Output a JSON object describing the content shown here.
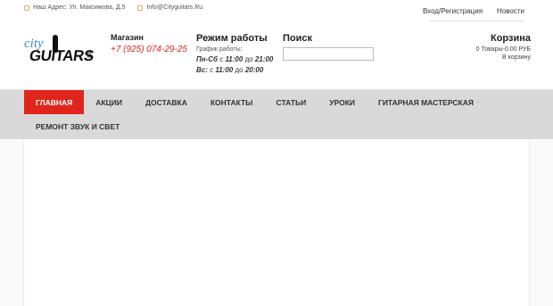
{
  "topbar": {
    "address": "Наш Адрес: Ул. Максимова, Д.5",
    "email": "Info@Cityguitars.Ru",
    "login": "Вход/Регистрация",
    "news": "Новости"
  },
  "logo": {
    "city": "city",
    "guitars": "GUITARS",
    "ru": ".ru"
  },
  "shop": {
    "label": "Магазин",
    "phone": "+7 (925) 074-29-25"
  },
  "hours": {
    "label": "Режим работы",
    "sub": "График работы:",
    "weekdays_days": "Пн-Сб",
    "weekdays_from_word": "с",
    "weekdays_from": "11:00",
    "weekdays_to_word": "до",
    "weekdays_to": "21:00",
    "sunday_day": "Вс:",
    "sunday_from_word": "с",
    "sunday_from": "11:00",
    "sunday_to_word": "до",
    "sunday_to": "20:00"
  },
  "search": {
    "label": "Поиск",
    "value": ""
  },
  "cart": {
    "label": "Корзина",
    "info": "0 Товары-0.00 РУБ",
    "link": "В корзину"
  },
  "nav": {
    "row1": [
      {
        "label": "ГЛАВНАЯ",
        "active": true
      },
      {
        "label": "АКЦИИ"
      },
      {
        "label": "ДОСТАВКА"
      },
      {
        "label": "КОНТАКТЫ"
      },
      {
        "label": "СТАТЬИ"
      },
      {
        "label": "УРОКИ"
      },
      {
        "label": "ГИТАРНАЯ МАСТЕРСКАЯ"
      }
    ],
    "row2": [
      {
        "label": "РЕМОНТ ЗВУК И СВЕТ"
      }
    ]
  },
  "colors": {
    "accent": "#e0261c",
    "nav_bg": "#d9d9d9",
    "logo_blue": "#3e8fd0"
  }
}
